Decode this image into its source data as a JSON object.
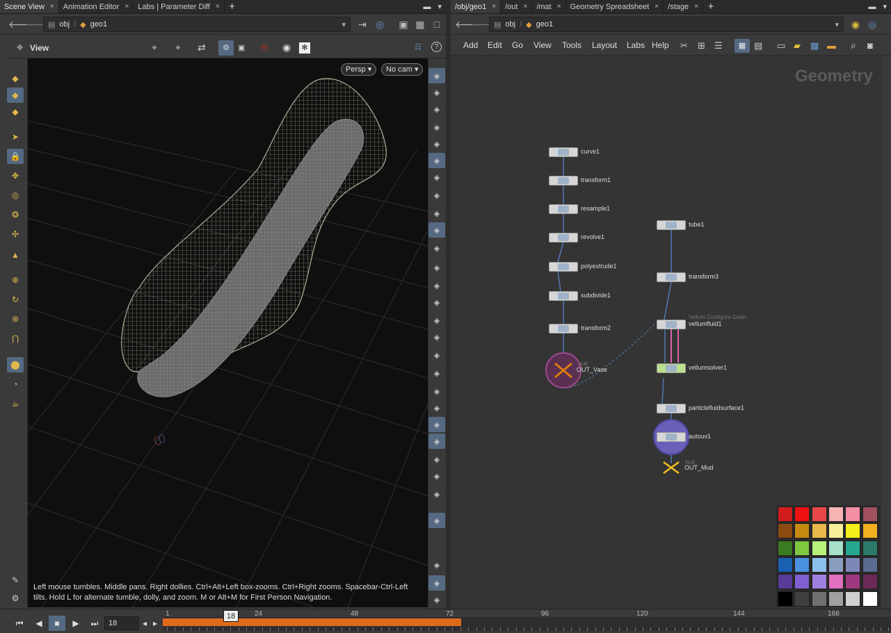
{
  "left_tabs": [
    {
      "label": "Scene View",
      "active": true
    },
    {
      "label": "Animation Editor",
      "active": false
    },
    {
      "label": "Labs | Parameter Diff",
      "active": false
    }
  ],
  "right_tabs": [
    {
      "label": "/obj/geo1",
      "active": true
    },
    {
      "label": "/out",
      "active": false
    },
    {
      "label": "/mat",
      "active": false
    },
    {
      "label": "Geometry Spreadsheet",
      "active": false
    },
    {
      "label": "/stage",
      "active": false
    }
  ],
  "path": {
    "obj": "obj",
    "geo": "geo1"
  },
  "viewport": {
    "label": "View",
    "persp": "Persp ▾",
    "camera": "No cam ▾",
    "help_text": "Left mouse tumbles. Middle pans. Right dollies. Ctrl+Alt+Left box-zooms. Ctrl+Right zooms. Spacebar-Ctrl-Left tilts. Hold L for alternate tumble, dolly, and zoom.     M or Alt+M for First Person Navigation."
  },
  "menu": [
    "Add",
    "Edit",
    "Go",
    "View",
    "Tools",
    "Layout",
    "Labs",
    "Help"
  ],
  "network_title": "Geometry",
  "nodes_left": [
    "curve1",
    "transform1",
    "resample1",
    "revolve1",
    "polyextrude1",
    "subdivide1",
    "transform2",
    "OUT_Vase"
  ],
  "nodes_right": [
    "tube1",
    "transform3",
    "vellumfluid1",
    "vellumsolver1",
    "particlefluidsurface1",
    "autouv1",
    "OUT_Mud"
  ],
  "node_subtitles": {
    "vellumfluid1": "Vellum Configure Grain",
    "OUT_Mud": "Null",
    "OUT_Vase": "Null"
  },
  "timeline": {
    "frame": "18",
    "ticks": [
      "1",
      "24",
      "48",
      "72",
      "96",
      "120",
      "144",
      "168"
    ],
    "current": "18"
  },
  "colors": {
    "accent": "#e06a1c",
    "wire": "#4f79b3",
    "panel": "#3a3a3a",
    "viewport": "#0f0f0f"
  },
  "palette": [
    "#d01c1c",
    "#ee1111",
    "#e84848",
    "#f5b3b3",
    "#f58fa6",
    "#a0505f",
    "#8a4a10",
    "#c48a10",
    "#e7b84a",
    "#f7ef9a",
    "#f4ee1a",
    "#f0b020",
    "#3a7a20",
    "#80c840",
    "#b8f07a",
    "#a6e0c8",
    "#26a890",
    "#2b7a6a",
    "#1a60b0",
    "#4a90e0",
    "#8cc0ec",
    "#8a9ec0",
    "#7c88b8",
    "#5a6a90",
    "#5a3a98",
    "#8060d0",
    "#a080e0",
    "#e070c0",
    "#a03880",
    "#6a2a5a",
    "#000000",
    "#404040",
    "#707070",
    "#a0a0a0",
    "#d0d0d0",
    "#ffffff"
  ]
}
